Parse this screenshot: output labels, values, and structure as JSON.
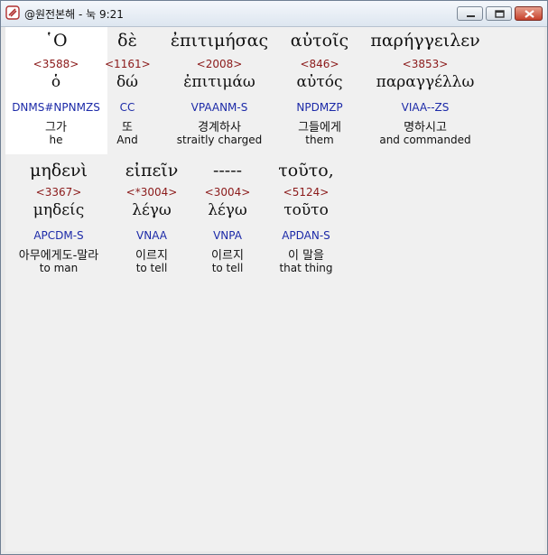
{
  "window": {
    "title": "@원전본해 - 눅 9:21"
  },
  "rows": [
    {
      "words": [
        {
          "greek": "῾Ο",
          "strong": "<3588>",
          "lemma": "ὁ",
          "parse": "DNMS#NPNMZS",
          "korean": "그가",
          "english": "he"
        },
        {
          "greek": "δὲ",
          "strong": "<1161>",
          "lemma": "δώ",
          "parse": "CC",
          "korean": "또",
          "english": "And"
        },
        {
          "greek": "ἐπιτιμήσας",
          "strong": "<2008>",
          "lemma": "ἐπιτιμάω",
          "parse": "VPAANM-S",
          "korean": "경계하사",
          "english": "straitly charged"
        },
        {
          "greek": "αὐτοῖς",
          "strong": "<846>",
          "lemma": "αὐτός",
          "parse": "NPDMZP",
          "korean": "그들에게",
          "english": "them"
        },
        {
          "greek": "παρήγγειλεν",
          "strong": "<3853>",
          "lemma": "παραγγέλλω",
          "parse": "VIAA--ZS",
          "korean": "명하시고",
          "english": "and commanded"
        }
      ]
    },
    {
      "words": [
        {
          "greek": "μηδενὶ",
          "strong": "<3367>",
          "lemma": "μηδείς",
          "parse": "APCDM-S",
          "korean": "아무에게도-말라",
          "english": "to man"
        },
        {
          "greek": "εἰπεῖν",
          "strong": "<*3004>",
          "lemma": "λέγω",
          "parse": "VNAA",
          "korean": "이르지",
          "english": "to tell"
        },
        {
          "greek": "-----",
          "strong": "<3004>",
          "lemma": "λέγω",
          "parse": "VNPA",
          "korean": "이르지",
          "english": "to tell"
        },
        {
          "greek": "τοῦτο,",
          "strong": "<5124>",
          "lemma": "τοῦτο",
          "parse": "APDAN-S",
          "korean": "이 말을",
          "english": "that thing"
        }
      ]
    }
  ]
}
